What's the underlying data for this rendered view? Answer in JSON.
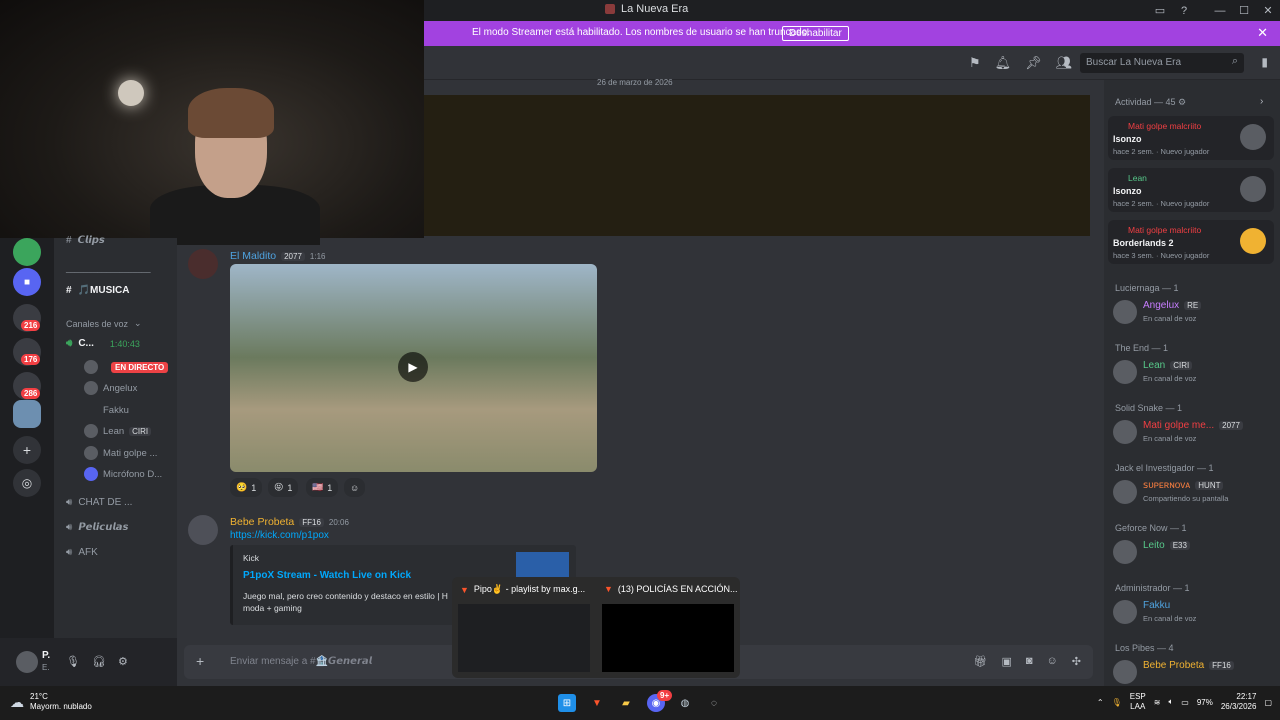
{
  "window": {
    "title": "La Nueva Era"
  },
  "banner": {
    "text": "El modo Streamer está habilitado. Los nombres de usuario se han truncado.",
    "button": "Deshabilitar"
  },
  "header": {
    "search_placeholder": "Buscar La Nueva Era"
  },
  "servers": [
    {
      "badge": "216"
    },
    {
      "badge": "176"
    },
    {
      "badge": "286"
    }
  ],
  "channels": {
    "clips": "𝘾𝙡𝙞𝙥𝙨",
    "divider": "___________________",
    "musica": "🎵MUSICA",
    "voice_header": "Canales de voz",
    "voice_channel_name": "C...",
    "voice_timer": "1:40:43",
    "voice_users": [
      {
        "name": "",
        "badge": "EN DIRECTO"
      },
      {
        "name": "Angelux",
        "tag": ""
      },
      {
        "name": "Fakku",
        "tag": ""
      },
      {
        "name": "Lean",
        "tag": "CIRI"
      },
      {
        "name": "Mati golpe ...",
        "tag": ""
      },
      {
        "name": "Micrófono D...",
        "tag": ""
      }
    ],
    "chat": "CHAT DE ...",
    "peliculas": "𝙋𝙚𝙡𝙞𝙘𝙪𝙡𝙖𝙨",
    "afk": "AFK"
  },
  "user_panel": {
    "name": "P.",
    "status": "E."
  },
  "chat": {
    "date": "26 de marzo de 2026",
    "messages": [
      {
        "author": "El Maldito",
        "author_color": "#4fa3e0",
        "tag": "2077",
        "time": "1:16",
        "reactions": [
          {
            "emoji": "🥺",
            "count": "1"
          },
          {
            "emoji": "😝",
            "count": "1"
          },
          {
            "emoji": "🇺🇸",
            "count": "1"
          }
        ]
      },
      {
        "author": "Bebe Probeta",
        "author_color": "#f0b232",
        "tag": "FF16",
        "time": "20:06",
        "link": "https://kick.com/p1pox",
        "embed": {
          "provider": "Kick",
          "title": "P1poX Stream - Watch Live on Kick",
          "description": "Juego mal, pero creo contenido y destaco en estilo | H moda + gaming"
        }
      }
    ],
    "composer_placeholder": "Enviar mensaje a #🏦𝙂𝙚𝙣𝙚𝙧𝙖𝙡"
  },
  "members": {
    "activity_header": "Actividad — 45",
    "activities": [
      {
        "user": "Mati golpe malcriito",
        "user_color": "#f23f43",
        "game": "Isonzo",
        "meta": "hace 2 sem.",
        "meta2": "Nuevo jugador"
      },
      {
        "user": "Lean",
        "user_color": "#57c98a",
        "game": "Isonzo",
        "meta": "hace 2 sem.",
        "meta2": "Nuevo jugador"
      },
      {
        "user": "Mati golpe malcriito",
        "user_color": "#f23f43",
        "game": "Borderlands 2",
        "meta": "hace 3 sem.",
        "meta2": "Nuevo jugador"
      }
    ],
    "groups": [
      {
        "header": "Luciernaga — 1",
        "name": "Angelux",
        "color": "#c77dff",
        "tag": "RE",
        "status": "En canal de voz"
      },
      {
        "header": "The End — 1",
        "name": "Lean",
        "color": "#57c98a",
        "tag": "CIRI",
        "status": "En canal de voz"
      },
      {
        "header": "Solid Snake — 1",
        "name": "Mati golpe me...",
        "color": "#f23f43",
        "tag": "2077",
        "status": "En canal de voz"
      },
      {
        "header": "Jack el Investigador — 1",
        "name": "ꜱᴜᴘᴇʀɴᴏᴠᴀ",
        "color": "#f07b3f",
        "tag": "HUNT",
        "status": "Compartiendo su pantalla"
      },
      {
        "header": "Geforce Now — 1",
        "name": "Leito",
        "color": "#57c98a",
        "tag": "E33",
        "status": ""
      },
      {
        "header": "Administrador — 1",
        "name": "Fakku",
        "color": "#4fa3e0",
        "tag": "",
        "status": "En canal de voz"
      },
      {
        "header": "Los Pibes — 4",
        "name": "Bebe Probeta",
        "color": "#f0b232",
        "tag": "FF16",
        "status": ""
      }
    ]
  },
  "taskbar": {
    "weather_temp": "21°C",
    "weather_desc": "Mayorm. nublado",
    "lang1": "ESP",
    "lang2": "LAA",
    "battery": "97%",
    "time": "22:17",
    "date": "26/3/2026",
    "discord_badge": "9+",
    "previews": [
      {
        "title": "Pipo✌️ - playlist by max.g..."
      },
      {
        "title": "(13) POLICÍAS EN ACCIÓN..."
      }
    ]
  }
}
